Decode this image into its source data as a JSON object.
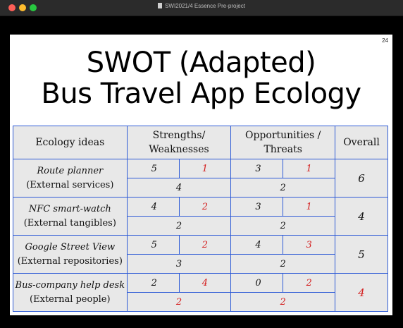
{
  "window": {
    "title": "SWI2021/4 Essence Pre-project"
  },
  "slide": {
    "page_number": "24",
    "title_line1": "SWOT (Adapted)",
    "title_line2": "Bus Travel App Ecology"
  },
  "table": {
    "headers": {
      "ideas": "Ecology ideas",
      "sw_line1": "Strengths/",
      "sw_line2": "Weaknesses",
      "ot_line1": "Opportunities /",
      "ot_line2": "Threats",
      "overall": "Overall"
    },
    "rows": [
      {
        "name": "Route planner",
        "category": "(External services)",
        "s": "5",
        "w": "1",
        "o": "3",
        "t": "1",
        "sw_total": "4",
        "ot_total": "2",
        "overall": "6"
      },
      {
        "name": "NFC smart-watch",
        "category": "(External tangibles)",
        "s": "4",
        "w": "2",
        "o": "3",
        "t": "1",
        "sw_total": "2",
        "ot_total": "2",
        "overall": "4"
      },
      {
        "name": "Google Street View",
        "category": "(External repositories)",
        "s": "5",
        "w": "2",
        "o": "4",
        "t": "3",
        "sw_total": "3",
        "ot_total": "2",
        "overall": "5"
      },
      {
        "name": "Bus-company help desk",
        "category": "(External people)",
        "s": "2",
        "w": "4",
        "o": "0",
        "t": "2",
        "sw_total": "2",
        "ot_total": "2",
        "overall": "4"
      }
    ],
    "colors": {
      "border": "#2e5bd6",
      "negative": "#d41f1f",
      "cell_bg": "#e8e8e8"
    }
  }
}
